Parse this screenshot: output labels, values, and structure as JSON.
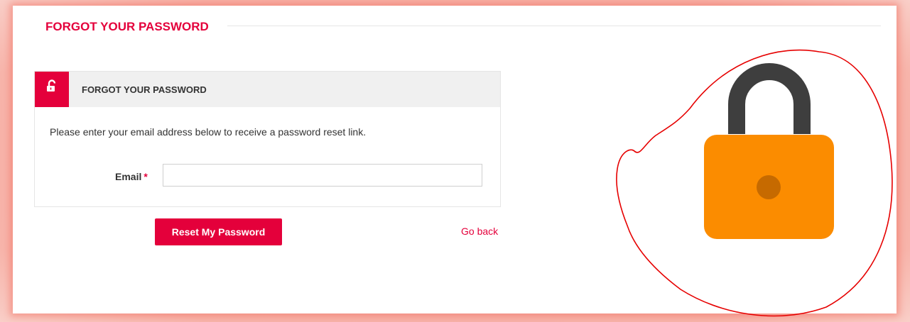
{
  "page": {
    "title": "FORGOT YOUR PASSWORD"
  },
  "card": {
    "title": "FORGOT YOUR PASSWORD",
    "icon": "unlock-icon",
    "description": "Please enter your email address below to receive a password reset link."
  },
  "form": {
    "email_label": "Email",
    "required_marker": "*",
    "email_value": "",
    "email_placeholder": ""
  },
  "actions": {
    "reset_label": "Reset My Password",
    "back_label": "Go back"
  },
  "illustration": {
    "icon": "padlock-icon",
    "annotation": "hand-drawn-circle"
  },
  "colors": {
    "accent": "#e4003b",
    "lock_body": "#fb8c00",
    "lock_shackle": "#3e3e3e",
    "lock_keyhole": "#c66a00",
    "annotation": "#e60000",
    "frame_glow": "#f5a79c"
  }
}
